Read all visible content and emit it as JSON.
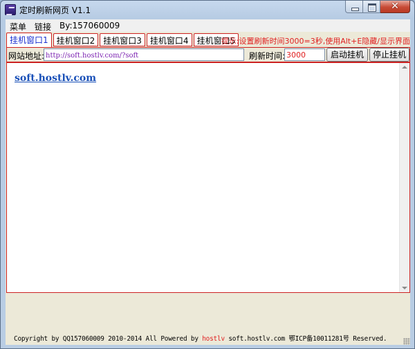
{
  "window": {
    "title": "定时刷新网页 V1.1",
    "close_glyph": "✕"
  },
  "menu": {
    "items": [
      "菜单",
      "链接",
      "By:157060009"
    ]
  },
  "tabs": [
    {
      "label": "挂机窗口1",
      "active": true
    },
    {
      "label": "挂机窗口2",
      "active": false
    },
    {
      "label": "挂机窗口3",
      "active": false
    },
    {
      "label": "挂机窗口4",
      "active": false
    },
    {
      "label": "挂机窗口5",
      "active": false
    }
  ],
  "tip": "提示:设置刷新时间3000=3秒,使用Alt+E隐藏/显示界面",
  "toolbar": {
    "url_label": "网站地址:",
    "url_value": "http://soft.hostlv.com/?soft",
    "interval_label": "刷新时间:",
    "interval_value": "3000",
    "start_button": "启动挂机",
    "stop_button": "停止挂机"
  },
  "browser": {
    "link_text": "soft.hostlv.com"
  },
  "footer": {
    "prefix": "Copyright by QQ157060009 2010-2014 All Powered by ",
    "brand": "hostlv",
    "suffix": " soft.hostlv.com 鄂ICP备10011281号 Reserved."
  },
  "colors": {
    "accent_red": "#e02020",
    "tab_active_text": "#1a2fd0",
    "link_blue": "#1950b8"
  }
}
